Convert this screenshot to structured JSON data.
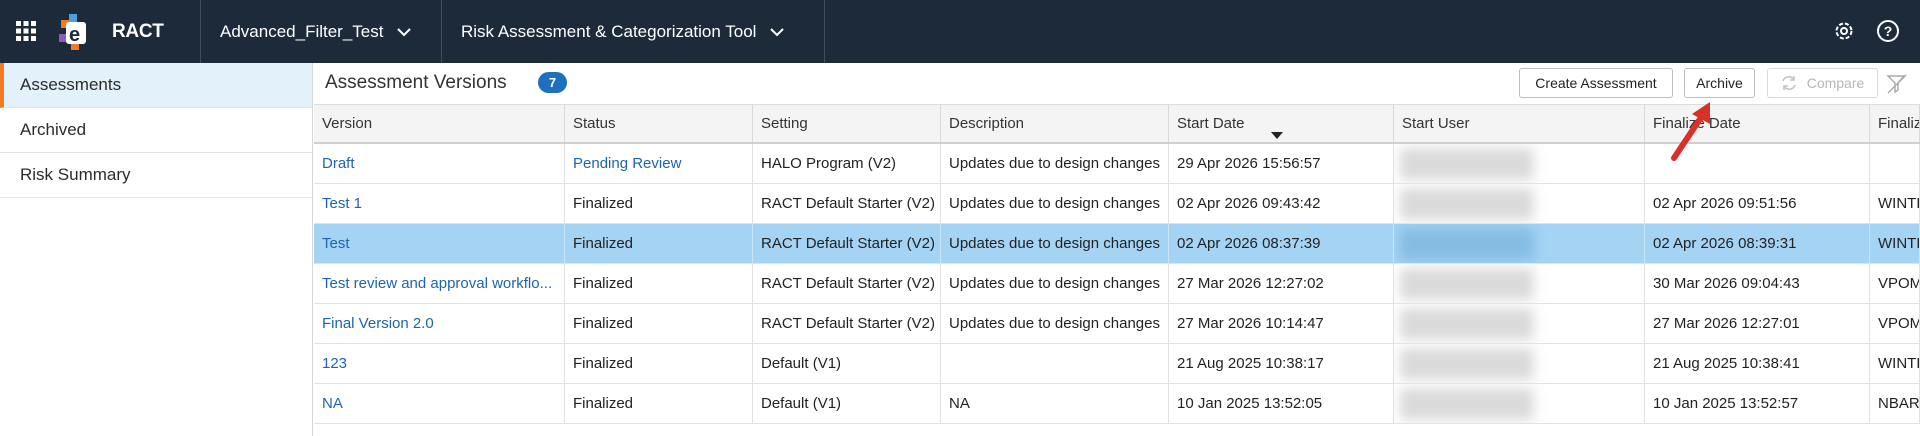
{
  "topbar": {
    "app_name": "RACT",
    "workspace": "Advanced_Filter_Test",
    "tool": "Risk Assessment & Categorization Tool",
    "icons": [
      "apps-grid-icon",
      "app-logo",
      "settings-icon",
      "help-icon"
    ]
  },
  "sidebar": {
    "items": [
      {
        "label": "Assessments",
        "active": true
      },
      {
        "label": "Archived",
        "active": false
      },
      {
        "label": "Risk Summary",
        "active": false
      }
    ]
  },
  "main": {
    "title": "Assessment Versions",
    "count": "7",
    "buttons": {
      "create": "Create Assessment",
      "archive": "Archive",
      "compare": "Compare"
    }
  },
  "table": {
    "columns": [
      "Version",
      "Status",
      "Setting",
      "Description",
      "Start Date",
      "Start User",
      "Finalize Date",
      "Finalize"
    ],
    "sorted_column": "Start Date",
    "sort_direction": "descending",
    "rows": [
      {
        "version": "Draft",
        "status": "Pending Review",
        "setting": "HALO Program (V2)",
        "description": "Updates due to design changes",
        "start_date": "29 Apr 2026 15:56:57",
        "finalize_date": "",
        "finalize_user": "",
        "selected": false
      },
      {
        "version": "Test 1",
        "status": "Finalized",
        "setting": "RACT Default Starter (V2)",
        "description": "Updates due to design changes",
        "start_date": "02 Apr 2026 09:43:42",
        "finalize_date": "02 Apr 2026 09:51:56",
        "finalize_user": "WINTE",
        "selected": false
      },
      {
        "version": "Test",
        "status": "Finalized",
        "setting": "RACT Default Starter (V2)",
        "description": "Updates due to design changes",
        "start_date": "02 Apr 2026 08:37:39",
        "finalize_date": "02 Apr 2026 08:39:31",
        "finalize_user": "WINTE",
        "selected": true
      },
      {
        "version": "Test review and approval workflo...",
        "status": "Finalized",
        "setting": "RACT Default Starter (V2)",
        "description": "Updates due to design changes",
        "start_date": "27 Mar 2026 12:27:02",
        "finalize_date": "30 Mar 2026 09:04:43",
        "finalize_user": "VPOM",
        "selected": false
      },
      {
        "version": "Final Version 2.0",
        "status": "Finalized",
        "setting": "RACT Default Starter (V2)",
        "description": "Updates due to design changes",
        "start_date": "27 Mar 2026 10:14:47",
        "finalize_date": "27 Mar 2026 12:27:01",
        "finalize_user": "VPOM",
        "selected": false
      },
      {
        "version": "123",
        "status": "Finalized",
        "setting": "Default (V1)",
        "description": "",
        "start_date": "21 Aug 2025 10:38:17",
        "finalize_date": "21 Aug 2025 10:38:41",
        "finalize_user": "WINTE",
        "selected": false
      },
      {
        "version": "NA",
        "status": "Finalized",
        "setting": "Default (V1)",
        "description": "NA",
        "start_date": "10 Jan 2025 13:52:05",
        "finalize_date": "10 Jan 2025 13:52:57",
        "finalize_user": "NBART",
        "selected": false
      }
    ]
  },
  "colors": {
    "topbar_bg": "#1c2a3a",
    "accent_orange": "#f07b22",
    "link_blue": "#1e64b0",
    "badge_blue": "#1f6fbf",
    "selected_row": "#a4d3f3",
    "annotation_arrow": "#d9302c"
  }
}
